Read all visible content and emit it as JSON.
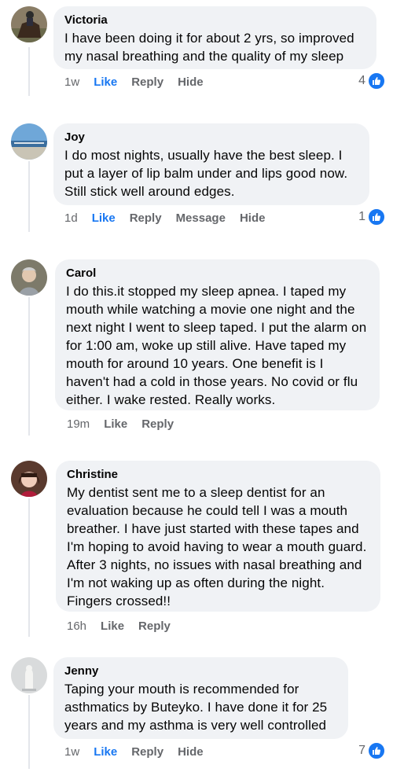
{
  "colors": {
    "accent": "#1877f2",
    "bubble": "#f0f2f5",
    "meta": "#65676b"
  },
  "comments": [
    {
      "author": "Victoria",
      "text": "I have been doing it for about 2 yrs, so improved my nasal breathing and the quality of my sleep",
      "time": "1w",
      "actions": [
        "Like",
        "Reply",
        "Hide"
      ],
      "reaction_count": "4",
      "reaction_icon": "like-icon"
    },
    {
      "author": "Joy",
      "text": "I do most nights, usually have the best sleep. I put a layer of lip balm under and lips good now. Still stick well around edges.",
      "time": "1d",
      "actions": [
        "Like",
        "Reply",
        "Message",
        "Hide"
      ],
      "reaction_count": "1",
      "reaction_icon": "like-icon"
    },
    {
      "author": "Carol",
      "text": "I do this.it stopped my sleep apnea. I taped my mouth while watching a movie one night and the next night I went to sleep taped. I put the alarm on for 1:00 am, woke up still alive. Have taped my mouth for around 10 years. One benefit is I haven't had a cold in those years. No covid or flu either. I wake rested. Really works.",
      "time": "19m",
      "actions": [
        "Like",
        "Reply"
      ]
    },
    {
      "author": "Christine",
      "text": "My dentist sent me to a sleep dentist for an evaluation because he could tell I was a mouth breather.  I have just started with these tapes and I'm hoping to avoid having to wear a mouth guard.  After 3 nights, no issues with nasal breathing and I'm not waking up as often during the night.  Fingers crossed!!",
      "time": "16h",
      "actions": [
        "Like",
        "Reply"
      ]
    },
    {
      "author": "Jenny",
      "text": "Taping your mouth is recommended for asthmatics by Buteyko. I have done it for 25 years and my asthma is very well controlled",
      "time": "1w",
      "actions": [
        "Like",
        "Reply",
        "Hide"
      ],
      "reaction_count": "7",
      "reaction_icon": "like-icon"
    }
  ]
}
